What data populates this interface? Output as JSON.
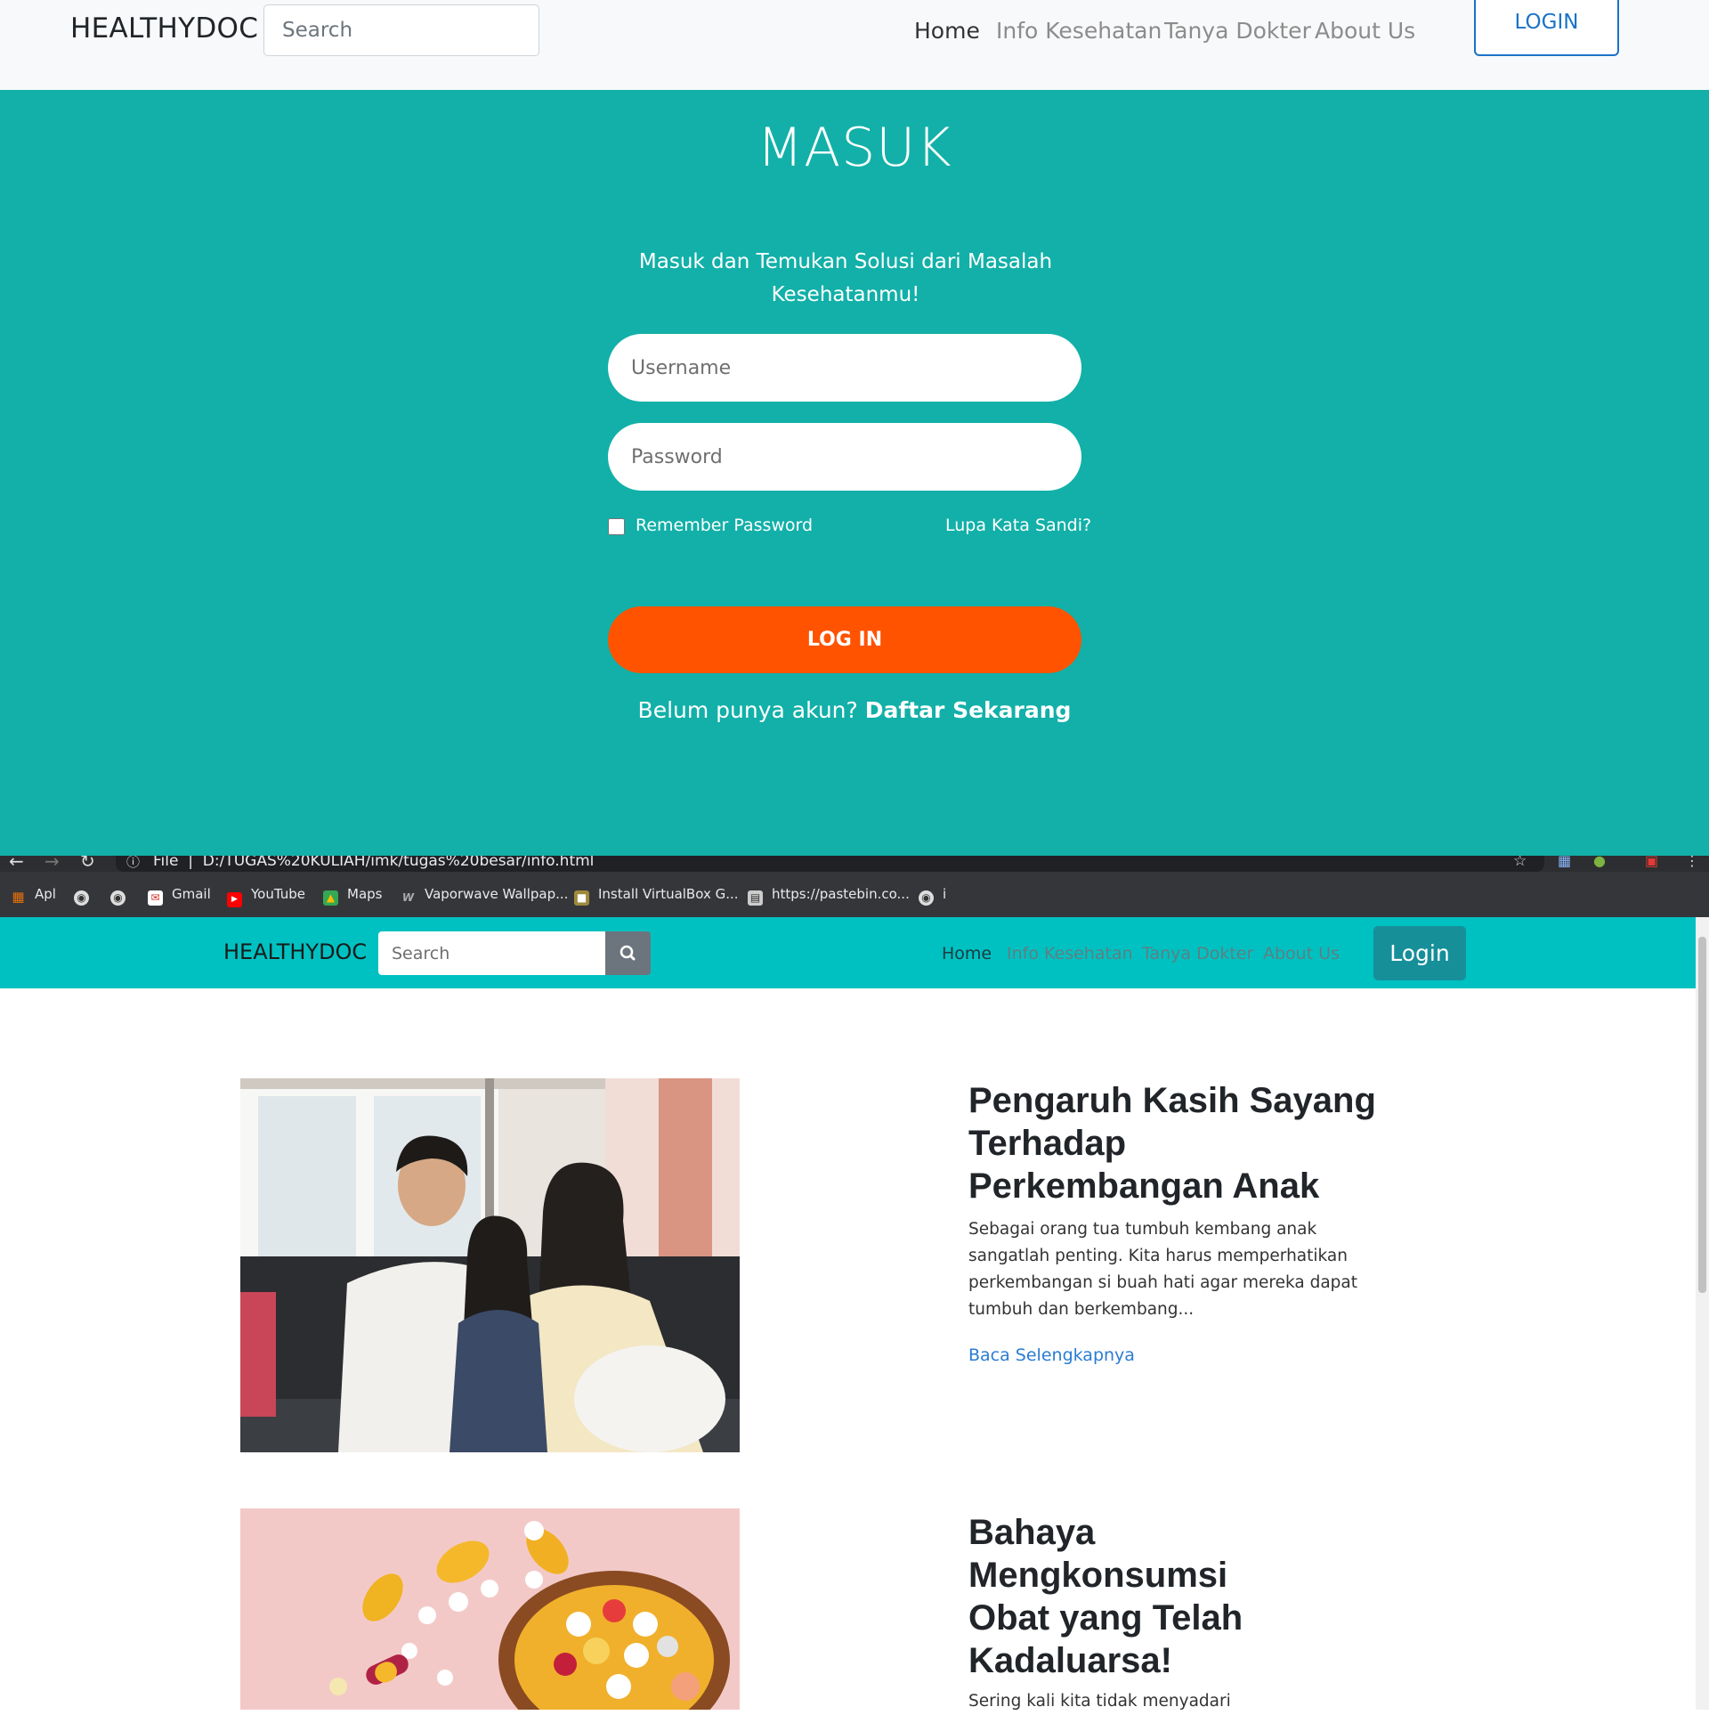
{
  "login_page": {
    "nav": {
      "brand": "HEALTHYDOC",
      "search_placeholder": "Search",
      "links": [
        "Home",
        "Info Kesehatan",
        "Tanya Dokter",
        "About Us"
      ],
      "login_button": "LOGIN"
    },
    "hero": {
      "title": "MASUK",
      "subtitle": "Masuk dan Temukan Solusi dari Masalah Kesehatanmu!",
      "username_placeholder": "Username",
      "password_placeholder": "Password",
      "remember_label": "Remember Password",
      "remember_checked": false,
      "forgot_link": "Lupa Kata Sandi?",
      "submit_label": "LOG IN",
      "signup_prompt": "Belum punya akun?",
      "signup_link": "Daftar Sekarang"
    },
    "colors": {
      "hero_bg": "#12b0a8",
      "submit_bg": "#ff5300",
      "login_outline": "#1a73c8"
    }
  },
  "browser": {
    "url_scheme": "File",
    "url": "D:/TUGAS%20KULIAH/imk/tugas%20besar/info.html",
    "bookmarks": [
      "Apl",
      "Gmail",
      "YouTube",
      "Maps",
      "Vaporwave Wallpap...",
      "Install VirtualBox G...",
      "https://pastebin.co...",
      "i"
    ]
  },
  "info_page": {
    "nav": {
      "brand": "HEALTHYDOC",
      "search_placeholder": "Search",
      "links": [
        "Home",
        "Info Kesehatan",
        "Tanya Dokter",
        "About Us"
      ],
      "login_button": "Login"
    },
    "articles": [
      {
        "title": "Pengaruh Kasih Sayang Terhadap Perkembangan Anak",
        "excerpt": "Sebagai orang tua tumbuh kembang anak sangatlah penting. Kita harus memperhatikan perkembangan si buah hati agar mereka dapat tumbuh dan berkembang...",
        "read_more": "Baca Selengkapnya"
      },
      {
        "title": "Bahaya Mengkonsumsi Obat yang Telah Kadaluarsa!",
        "excerpt": "Sering kali kita tidak menyadari"
      }
    ],
    "colors": {
      "nav_bg": "#00c1c1",
      "login_bg": "#168f99",
      "link": "#2a7cd4"
    }
  }
}
